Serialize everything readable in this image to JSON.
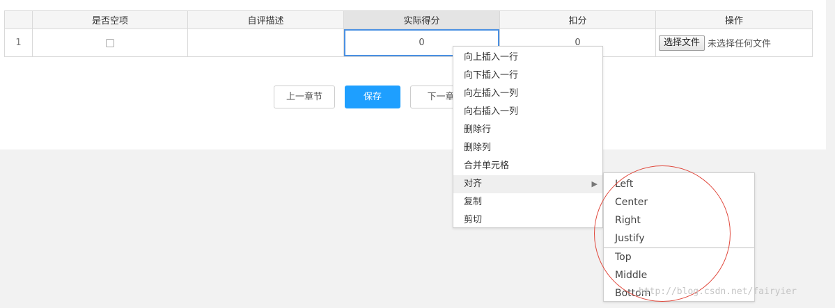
{
  "table": {
    "headers": [
      "",
      "是否空项",
      "自评描述",
      "实际得分",
      "扣分",
      "操作"
    ],
    "rows": [
      {
        "index": "1",
        "description": "",
        "actual_score": "0",
        "deduction": "0"
      }
    ],
    "file_button_label": "选择文件",
    "file_status": "未选择任何文件"
  },
  "nav": {
    "prev_label": "上一章节",
    "save_label": "保存",
    "next_label_visible": "下一章"
  },
  "context_menu": {
    "items": [
      "向上插入一行",
      "向下插入一行",
      "向左插入一列",
      "向右插入一列",
      "删除行",
      "删除列",
      "合并单元格",
      "对齐",
      "复制",
      "剪切"
    ],
    "submenu_arrow": "▶"
  },
  "align_submenu": {
    "horizontal": [
      "Left",
      "Center",
      "Right",
      "Justify"
    ],
    "vertical": [
      "Top",
      "Middle",
      "Bottom"
    ]
  },
  "watermark": "http://blog.csdn.net/fairyier",
  "colors": {
    "primary": "#1e9fff",
    "selection_border": "#4a90e2",
    "annotation": "#e0483c",
    "page_background": "#f2f2f2"
  }
}
